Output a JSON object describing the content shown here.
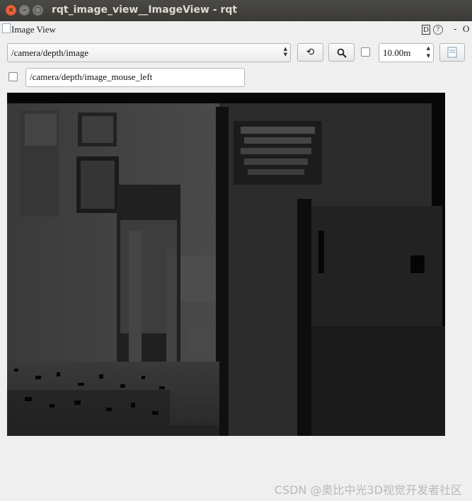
{
  "window": {
    "title": "rqt_image_view__ImageView - rqt",
    "close_glyph": "×",
    "minimize_glyph": "–",
    "maximize_glyph": "□"
  },
  "plugin": {
    "title": "Image View",
    "d_label": "D",
    "help_glyph": "?",
    "dash_glyph": "-",
    "close_label": "O"
  },
  "toolbar": {
    "topic_value": "/camera/depth/image",
    "refresh_glyph": "⟲",
    "zoom_glyph": "🔍",
    "max_depth_value": "10.00m",
    "spin_up": "▲",
    "spin_down": "▼",
    "combo_up": "▲",
    "combo_down": "▼"
  },
  "mouse": {
    "topic_value": "/camera/depth/image_mouse_left"
  },
  "watermark": "CSDN @奥比中光3D视觉开发者社区",
  "colors": {
    "titlebar": "#3f3e3a",
    "window_bg": "#efefef",
    "close_button": "#e2572d",
    "image_bg": "#070707"
  }
}
